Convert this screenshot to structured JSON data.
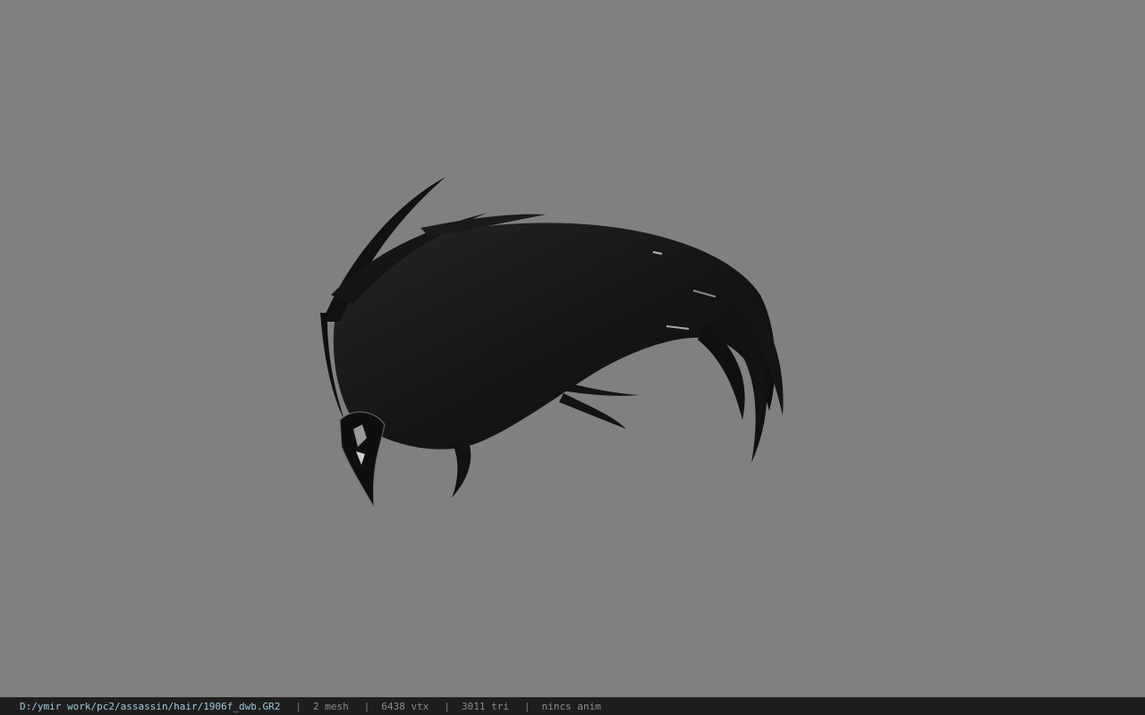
{
  "viewport": {
    "background": "#808080",
    "model_color": "#161616"
  },
  "status": {
    "path": "D:/ymir work/pc2/assassin/hair/1906f_dwb.GR2",
    "separator": "|",
    "mesh": "2 mesh",
    "vtx": "6438 vtx",
    "tri": "3011 tri",
    "anim": "nincs anim"
  }
}
